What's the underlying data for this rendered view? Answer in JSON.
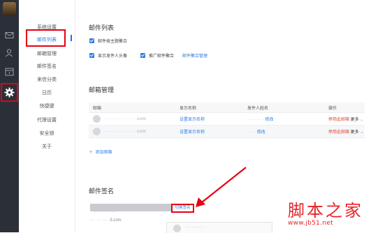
{
  "colors": {
    "accent": "#2f7de1",
    "highlight": "#e60012",
    "rail": "#2b3038",
    "danger": "#e0482f"
  },
  "rail": {
    "icons": [
      "avatar",
      "mail-icon",
      "contacts-icon",
      "calendar-icon",
      "gear-icon"
    ]
  },
  "subnav": {
    "items": [
      "系统设置",
      "邮件列表",
      "邮箱管理",
      "邮件签名",
      "来信分类",
      "日历",
      "快捷键",
      "代理设置",
      "安全锁",
      "关于"
    ],
    "active": "邮件列表"
  },
  "mail_list": {
    "title": "邮件列表",
    "option_merge_subject": "邮件按主题聚合",
    "option_show_avatar": "显示发件人头像",
    "option_promo_merge": "推广邮件聚合",
    "link_aggregate_manage": "邮件聚合管理"
  },
  "mailbox": {
    "title": "邮箱管理",
    "columns": [
      "邮箱",
      "显示名称",
      "发件人姓名",
      "操作"
    ],
    "rows": [
      {
        "email": "·· · ·· · · · ·· · ·com",
        "display": "设置显示名称",
        "sender": "·· ·· ·· ·",
        "edit": "修改",
        "disable": "停用此邮箱",
        "more": "更多"
      },
      {
        "email": "· · · ·· · · ··· · ·com",
        "display": "设置显示名称",
        "sender": "·· ··",
        "edit": "修改",
        "disable": "停用此邮箱",
        "more": "更多"
      }
    ],
    "add_label": "添加邮箱"
  },
  "signature": {
    "title": "邮件签名",
    "row1_email": "·· · ·· ·· · ·· ·",
    "switch_label": "切换签名",
    "row2_email": "·· · ·· · ··· ·3.com",
    "preview_name": "·· · · ·· · · ·"
  },
  "watermark": {
    "main": "脚本之家",
    "url": "www.jb51.net"
  }
}
